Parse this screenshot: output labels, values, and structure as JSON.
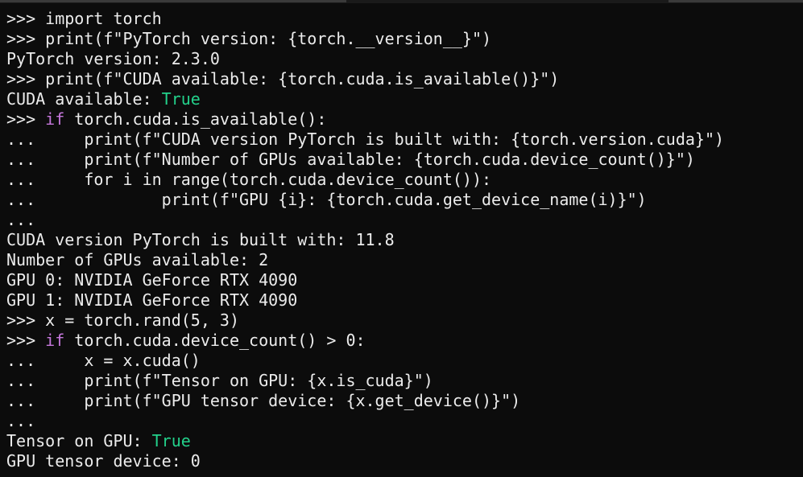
{
  "terminal": {
    "lines": [
      {
        "type": "input",
        "prompt": ">>>",
        "code": " import torch"
      },
      {
        "type": "input",
        "prompt": ">>>",
        "code": " print(f\"PyTorch version: {torch.__version__}\")"
      },
      {
        "type": "output",
        "text": "PyTorch version: 2.3.0"
      },
      {
        "type": "input",
        "prompt": ">>>",
        "code": " print(f\"CUDA available: {torch.cuda.is_available()}\")"
      },
      {
        "type": "output",
        "text": "CUDA available: ",
        "value": "True"
      },
      {
        "type": "input",
        "prompt": ">>>",
        "keyword": "if",
        "code": " torch.cuda.is_available():"
      },
      {
        "type": "input",
        "prompt": "...",
        "code": "     print(f\"CUDA version PyTorch is built with: {torch.version.cuda}\")"
      },
      {
        "type": "input",
        "prompt": "...",
        "code": "     print(f\"Number of GPUs available: {torch.cuda.device_count()}\")"
      },
      {
        "type": "input",
        "prompt": "...",
        "code": "     for i in range(torch.cuda.device_count()):"
      },
      {
        "type": "input",
        "prompt": "...",
        "code": "             print(f\"GPU {i}: {torch.cuda.get_device_name(i)}\")"
      },
      {
        "type": "input",
        "prompt": "...",
        "code": ""
      },
      {
        "type": "output",
        "text": "CUDA version PyTorch is built with: 11.8"
      },
      {
        "type": "output",
        "text": "Number of GPUs available: 2"
      },
      {
        "type": "output",
        "text": "GPU 0: NVIDIA GeForce RTX 4090"
      },
      {
        "type": "output",
        "text": "GPU 1: NVIDIA GeForce RTX 4090"
      },
      {
        "type": "input",
        "prompt": ">>>",
        "code": " x = torch.rand(5, 3)"
      },
      {
        "type": "input",
        "prompt": ">>>",
        "keyword": "if",
        "code": " torch.cuda.device_count() > 0:"
      },
      {
        "type": "input",
        "prompt": "...",
        "code": "     x = x.cuda()"
      },
      {
        "type": "input",
        "prompt": "...",
        "code": "     print(f\"Tensor on GPU: {x.is_cuda}\")"
      },
      {
        "type": "input",
        "prompt": "...",
        "code": "     print(f\"GPU tensor device: {x.get_device()}\")"
      },
      {
        "type": "input",
        "prompt": "...",
        "code": ""
      },
      {
        "type": "output",
        "text": "Tensor on GPU: ",
        "value": "True"
      },
      {
        "type": "output",
        "text": "GPU tensor device: 0"
      }
    ]
  },
  "colors": {
    "background": "#0c0c0c",
    "foreground": "#ececec",
    "keyword": "#c678dd",
    "boolean": "#23d18b"
  }
}
